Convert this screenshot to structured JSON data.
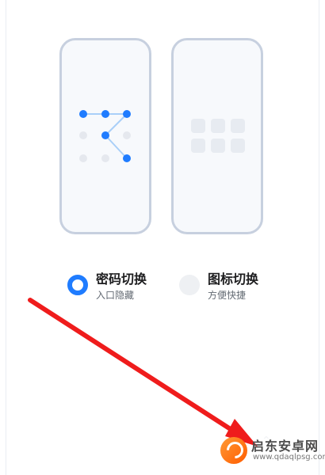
{
  "options": [
    {
      "title": "密码切换",
      "subtitle": "入口隐藏",
      "selected": true
    },
    {
      "title": "图标切换",
      "subtitle": "方便快捷",
      "selected": false
    }
  ],
  "preview_cards": [
    {
      "type": "pattern-lock",
      "pattern_color": "#1f7cff",
      "line_color": "#a9cff8",
      "dot_color_inactive": "#e5e8ee"
    },
    {
      "type": "icon-grid",
      "icon_color": "#e7ebf1"
    }
  ],
  "annotation": {
    "color": "#ef1c1c"
  },
  "watermark": {
    "name": "启东安卓网",
    "domain": "www.qdaqlpsg.com"
  },
  "colors": {
    "accent": "#1f7cff",
    "card_border": "#c7d0df",
    "card_background": "#f7f9fc"
  }
}
